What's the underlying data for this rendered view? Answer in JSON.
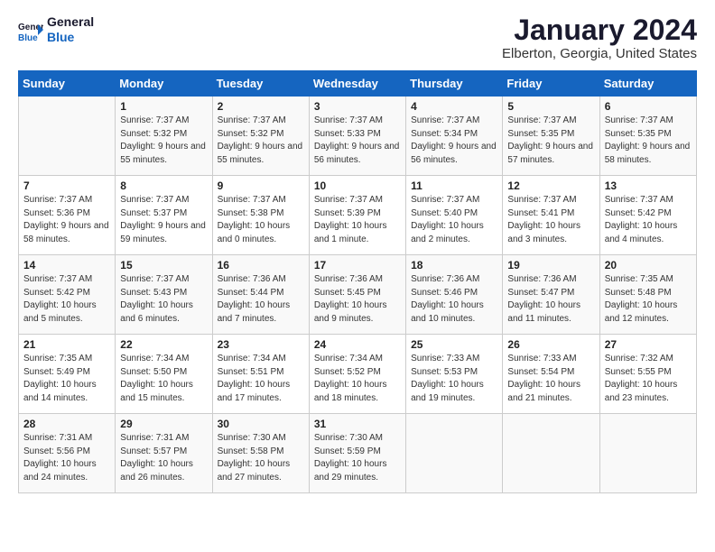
{
  "logo": {
    "line1": "General",
    "line2": "Blue"
  },
  "title": "January 2024",
  "subtitle": "Elberton, Georgia, United States",
  "weekdays": [
    "Sunday",
    "Monday",
    "Tuesday",
    "Wednesday",
    "Thursday",
    "Friday",
    "Saturday"
  ],
  "weeks": [
    [
      {
        "day": "",
        "sunrise": "",
        "sunset": "",
        "daylight": ""
      },
      {
        "day": "1",
        "sunrise": "7:37 AM",
        "sunset": "5:32 PM",
        "daylight": "9 hours and 55 minutes."
      },
      {
        "day": "2",
        "sunrise": "7:37 AM",
        "sunset": "5:32 PM",
        "daylight": "9 hours and 55 minutes."
      },
      {
        "day": "3",
        "sunrise": "7:37 AM",
        "sunset": "5:33 PM",
        "daylight": "9 hours and 56 minutes."
      },
      {
        "day": "4",
        "sunrise": "7:37 AM",
        "sunset": "5:34 PM",
        "daylight": "9 hours and 56 minutes."
      },
      {
        "day": "5",
        "sunrise": "7:37 AM",
        "sunset": "5:35 PM",
        "daylight": "9 hours and 57 minutes."
      },
      {
        "day": "6",
        "sunrise": "7:37 AM",
        "sunset": "5:35 PM",
        "daylight": "9 hours and 58 minutes."
      }
    ],
    [
      {
        "day": "7",
        "sunrise": "7:37 AM",
        "sunset": "5:36 PM",
        "daylight": "9 hours and 58 minutes."
      },
      {
        "day": "8",
        "sunrise": "7:37 AM",
        "sunset": "5:37 PM",
        "daylight": "9 hours and 59 minutes."
      },
      {
        "day": "9",
        "sunrise": "7:37 AM",
        "sunset": "5:38 PM",
        "daylight": "10 hours and 0 minutes."
      },
      {
        "day": "10",
        "sunrise": "7:37 AM",
        "sunset": "5:39 PM",
        "daylight": "10 hours and 1 minute."
      },
      {
        "day": "11",
        "sunrise": "7:37 AM",
        "sunset": "5:40 PM",
        "daylight": "10 hours and 2 minutes."
      },
      {
        "day": "12",
        "sunrise": "7:37 AM",
        "sunset": "5:41 PM",
        "daylight": "10 hours and 3 minutes."
      },
      {
        "day": "13",
        "sunrise": "7:37 AM",
        "sunset": "5:42 PM",
        "daylight": "10 hours and 4 minutes."
      }
    ],
    [
      {
        "day": "14",
        "sunrise": "7:37 AM",
        "sunset": "5:42 PM",
        "daylight": "10 hours and 5 minutes."
      },
      {
        "day": "15",
        "sunrise": "7:37 AM",
        "sunset": "5:43 PM",
        "daylight": "10 hours and 6 minutes."
      },
      {
        "day": "16",
        "sunrise": "7:36 AM",
        "sunset": "5:44 PM",
        "daylight": "10 hours and 7 minutes."
      },
      {
        "day": "17",
        "sunrise": "7:36 AM",
        "sunset": "5:45 PM",
        "daylight": "10 hours and 9 minutes."
      },
      {
        "day": "18",
        "sunrise": "7:36 AM",
        "sunset": "5:46 PM",
        "daylight": "10 hours and 10 minutes."
      },
      {
        "day": "19",
        "sunrise": "7:36 AM",
        "sunset": "5:47 PM",
        "daylight": "10 hours and 11 minutes."
      },
      {
        "day": "20",
        "sunrise": "7:35 AM",
        "sunset": "5:48 PM",
        "daylight": "10 hours and 12 minutes."
      }
    ],
    [
      {
        "day": "21",
        "sunrise": "7:35 AM",
        "sunset": "5:49 PM",
        "daylight": "10 hours and 14 minutes."
      },
      {
        "day": "22",
        "sunrise": "7:34 AM",
        "sunset": "5:50 PM",
        "daylight": "10 hours and 15 minutes."
      },
      {
        "day": "23",
        "sunrise": "7:34 AM",
        "sunset": "5:51 PM",
        "daylight": "10 hours and 17 minutes."
      },
      {
        "day": "24",
        "sunrise": "7:34 AM",
        "sunset": "5:52 PM",
        "daylight": "10 hours and 18 minutes."
      },
      {
        "day": "25",
        "sunrise": "7:33 AM",
        "sunset": "5:53 PM",
        "daylight": "10 hours and 19 minutes."
      },
      {
        "day": "26",
        "sunrise": "7:33 AM",
        "sunset": "5:54 PM",
        "daylight": "10 hours and 21 minutes."
      },
      {
        "day": "27",
        "sunrise": "7:32 AM",
        "sunset": "5:55 PM",
        "daylight": "10 hours and 23 minutes."
      }
    ],
    [
      {
        "day": "28",
        "sunrise": "7:31 AM",
        "sunset": "5:56 PM",
        "daylight": "10 hours and 24 minutes."
      },
      {
        "day": "29",
        "sunrise": "7:31 AM",
        "sunset": "5:57 PM",
        "daylight": "10 hours and 26 minutes."
      },
      {
        "day": "30",
        "sunrise": "7:30 AM",
        "sunset": "5:58 PM",
        "daylight": "10 hours and 27 minutes."
      },
      {
        "day": "31",
        "sunrise": "7:30 AM",
        "sunset": "5:59 PM",
        "daylight": "10 hours and 29 minutes."
      },
      {
        "day": "",
        "sunrise": "",
        "sunset": "",
        "daylight": ""
      },
      {
        "day": "",
        "sunrise": "",
        "sunset": "",
        "daylight": ""
      },
      {
        "day": "",
        "sunrise": "",
        "sunset": "",
        "daylight": ""
      }
    ]
  ],
  "labels": {
    "sunrise_prefix": "Sunrise: ",
    "sunset_prefix": "Sunset: ",
    "daylight_prefix": "Daylight: "
  }
}
